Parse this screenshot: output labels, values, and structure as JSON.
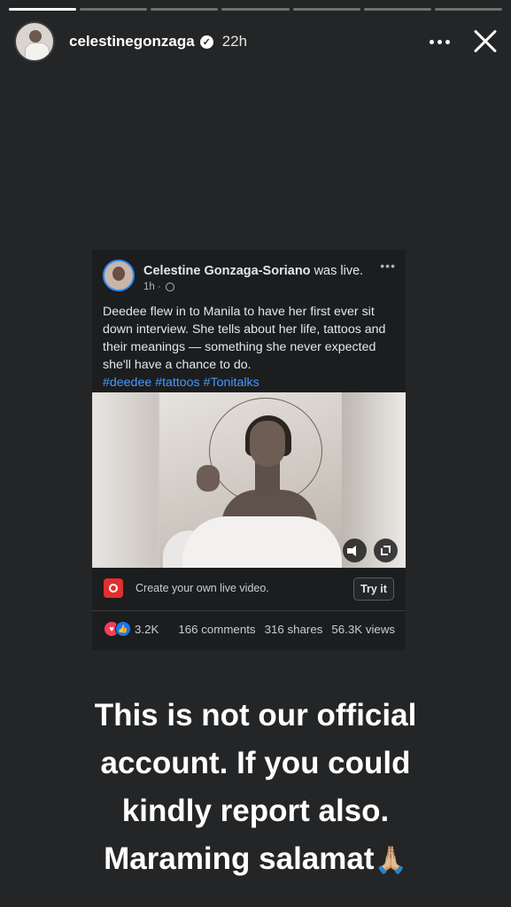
{
  "story": {
    "progress_segments": 7,
    "progress_done": 1,
    "username": "celestinegonzaga",
    "time_ago": "22h",
    "verified_icon": "check-icon",
    "more_icon": "more-icon",
    "close_icon": "close-icon"
  },
  "post": {
    "author": "Celestine Gonzaga-Soriano",
    "action": " was live.",
    "time": "1h ·",
    "globe_icon": "globe-icon",
    "text": "Deedee flew in to Manila to have her first ever sit down interview. She tells about her life, tattoos and their meanings — something she never expected she'll have a chance to do.",
    "hashtags": "#deedee #tattoos #Tonitalks",
    "live_prompt": "Create your own live video.",
    "try_label": "Try it",
    "reactions_count": "3.2K",
    "comments": "166 comments",
    "shares": "316 shares",
    "views": "56.3K views"
  },
  "caption": {
    "lines": [
      "This is not our official",
      "account. If you could",
      "kindly report also.",
      "Maraming salamat"
    ],
    "emoji": "🙏🏼"
  }
}
